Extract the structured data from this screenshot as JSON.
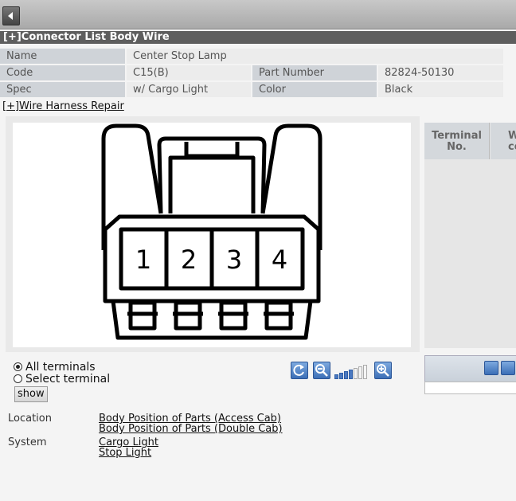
{
  "title": {
    "connector_list": "[+]Connector List  Body  Wire"
  },
  "info": {
    "name_label": "Name",
    "name_value": "Center Stop Lamp",
    "code_label": "Code",
    "code_value": "C15(B)",
    "part_label": "Part Number",
    "part_value": "82824-50130",
    "spec_label": "Spec",
    "spec_value": "w/ Cargo Light",
    "color_label": "Color",
    "color_value": "Black"
  },
  "wire_harness_link": "[+]Wire Harness Repair",
  "connector": {
    "pins": [
      "1",
      "2",
      "3",
      "4"
    ]
  },
  "terminal_table": {
    "col1": "Terminal No.",
    "col2": "W co"
  },
  "filter": {
    "all_terminals": "All terminals",
    "select_terminal": "Select terminal",
    "selected": "all",
    "show_label": "show"
  },
  "zoom": {
    "level_fraction": 0.57
  },
  "location": {
    "label": "Location",
    "links": [
      "Body  Position of Parts (Access Cab)",
      "Body  Position of Parts (Double Cab)"
    ]
  },
  "system": {
    "label": "System",
    "links": [
      "Cargo Light",
      "Stop Light"
    ]
  },
  "icons": {
    "back": "back-arrow-icon",
    "reset": "refresh-icon",
    "zoom_out": "zoom-out-icon",
    "zoom_in": "zoom-in-icon",
    "fit": "fit-icon"
  }
}
